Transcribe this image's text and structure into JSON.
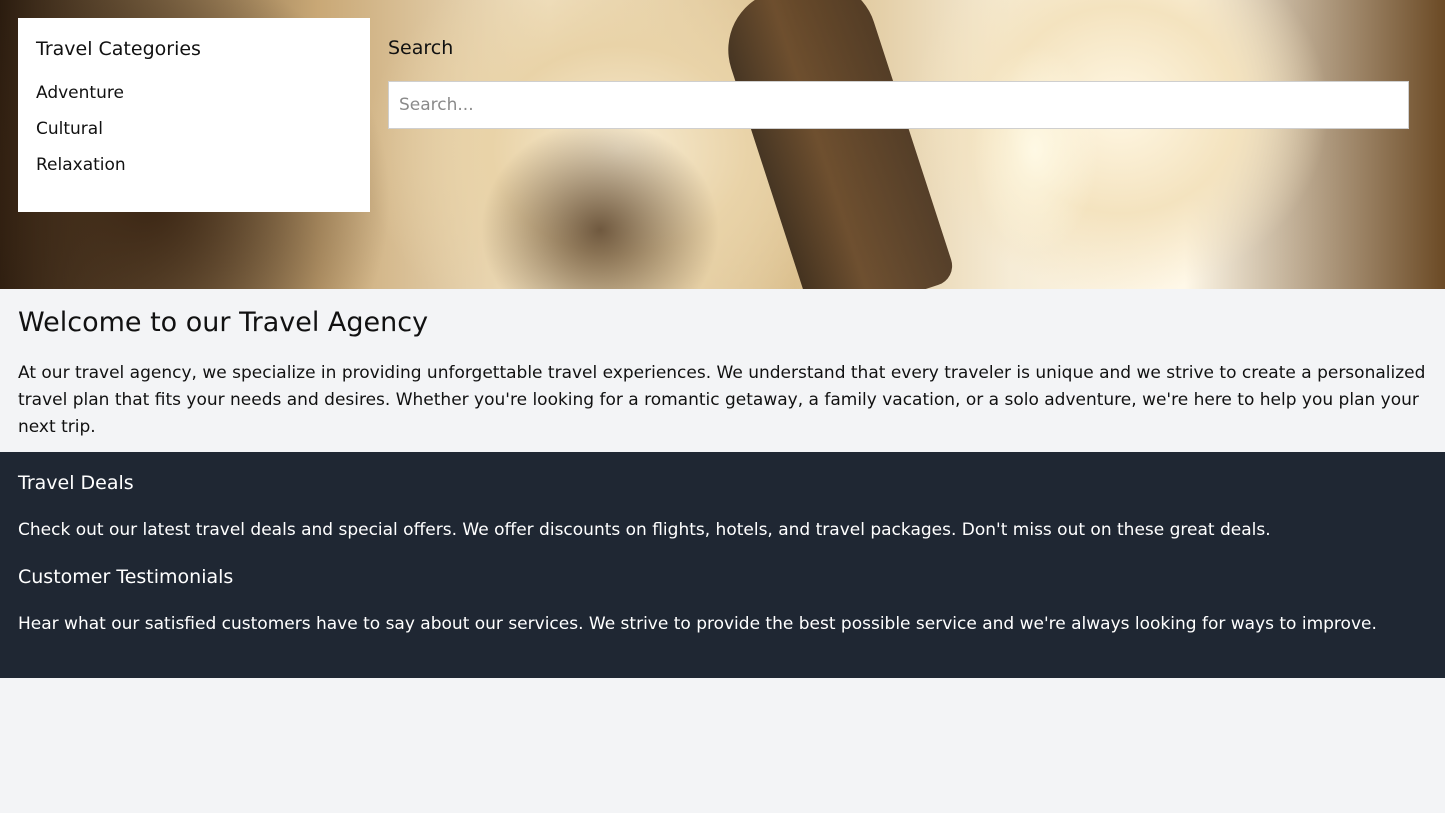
{
  "categories": {
    "title": "Travel Categories",
    "items": [
      {
        "label": "Adventure"
      },
      {
        "label": "Cultural"
      },
      {
        "label": "Relaxation"
      }
    ]
  },
  "search": {
    "label": "Search",
    "placeholder": "Search..."
  },
  "welcome": {
    "title": "Welcome to our Travel Agency",
    "body": "At our travel agency, we specialize in providing unforgettable travel experiences. We understand that every traveler is unique and we strive to create a personalized travel plan that fits your needs and desires. Whether you're looking for a romantic getaway, a family vacation, or a solo adventure, we're here to help you plan your next trip."
  },
  "footer_sections": [
    {
      "title": "Travel Deals",
      "body": "Check out our latest travel deals and special offers. We offer discounts on flights, hotels, and travel packages. Don't miss out on these great deals."
    },
    {
      "title": "Customer Testimonials",
      "body": "Hear what our satisfied customers have to say about our services. We strive to provide the best possible service and we're always looking for ways to improve."
    }
  ],
  "colors": {
    "page_background": "#f3f4f6",
    "dark_section": "#1f2733",
    "panel": "#ffffff"
  }
}
